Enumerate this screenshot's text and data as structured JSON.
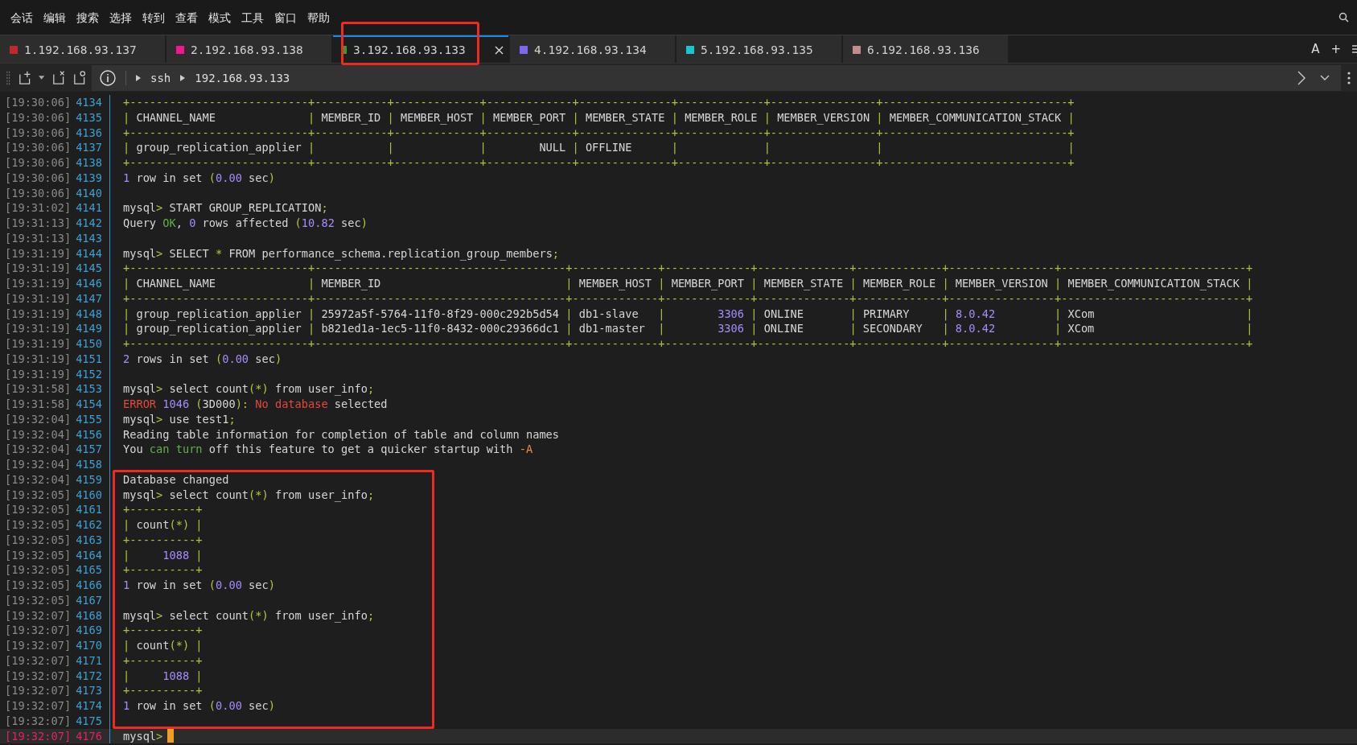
{
  "menu": [
    "会话",
    "编辑",
    "搜索",
    "选择",
    "转到",
    "查看",
    "模式",
    "工具",
    "窗口",
    "帮助"
  ],
  "tabs": [
    {
      "label": "1.192.168.93.137",
      "color": "#c0282d",
      "selected": false,
      "highlighted": false
    },
    {
      "label": "2.192.168.93.138",
      "color": "#f0168c",
      "selected": false,
      "highlighted": false
    },
    {
      "label": "3.192.168.93.133",
      "color": "#2e9e2e",
      "selected": true,
      "highlighted": true
    },
    {
      "label": "4.192.168.93.134",
      "color": "#7b68ee",
      "selected": false,
      "highlighted": false
    },
    {
      "label": "5.192.168.93.135",
      "color": "#14c8d0",
      "selected": false,
      "highlighted": false
    },
    {
      "label": "6.192.168.93.136",
      "color": "#c08c8c",
      "selected": false,
      "highlighted": false
    }
  ],
  "tab_bar_actions": [
    "A",
    "+"
  ],
  "toolbar": {
    "breadcrumb": [
      "ssh",
      "192.168.93.133"
    ]
  },
  "terminal": {
    "lines": [
      {
        "time": "[19:30:06]",
        "number": "4134",
        "current": false,
        "highlighted": false,
        "segments": [
          {
            "text": "+---------------------------+-----------+-------------+-------------+--------------+-------------+----------------+----------------------------+",
            "kind": "border"
          }
        ]
      },
      {
        "time": "[19:30:06]",
        "number": "4135",
        "current": false,
        "highlighted": false,
        "segments": [
          {
            "text": "| ",
            "kind": "border"
          },
          {
            "text": "CHANNEL_NAME",
            "kind": "text"
          },
          {
            "text": "              | ",
            "kind": "border"
          },
          {
            "text": "MEMBER_ID",
            "kind": "text"
          },
          {
            "text": " | ",
            "kind": "border"
          },
          {
            "text": "MEMBER_HOST",
            "kind": "text"
          },
          {
            "text": " | ",
            "kind": "border"
          },
          {
            "text": "MEMBER_PORT",
            "kind": "text"
          },
          {
            "text": " | ",
            "kind": "border"
          },
          {
            "text": "MEMBER_STATE",
            "kind": "text"
          },
          {
            "text": " | ",
            "kind": "border"
          },
          {
            "text": "MEMBER_ROLE",
            "kind": "text"
          },
          {
            "text": " | ",
            "kind": "border"
          },
          {
            "text": "MEMBER_VERSION",
            "kind": "text"
          },
          {
            "text": " | ",
            "kind": "border"
          },
          {
            "text": "MEMBER_COMMUNICATION_STACK",
            "kind": "text"
          },
          {
            "text": " |",
            "kind": "border"
          }
        ]
      },
      {
        "time": "[19:30:06]",
        "number": "4136",
        "current": false,
        "highlighted": false,
        "segments": [
          {
            "text": "+---------------------------+-----------+-------------+-------------+--------------+-------------+----------------+----------------------------+",
            "kind": "border"
          }
        ]
      },
      {
        "time": "[19:30:06]",
        "number": "4137",
        "current": false,
        "highlighted": false,
        "segments": [
          {
            "text": "| ",
            "kind": "border"
          },
          {
            "text": "group_replication_applier",
            "kind": "text"
          },
          {
            "text": " |           |             |        ",
            "kind": "border"
          },
          {
            "text": "NULL",
            "kind": "text"
          },
          {
            "text": " | ",
            "kind": "border"
          },
          {
            "text": "OFFLINE",
            "kind": "text"
          },
          {
            "text": "      |             |                |                            |",
            "kind": "border"
          }
        ]
      },
      {
        "time": "[19:30:06]",
        "number": "4138",
        "current": false,
        "highlighted": false,
        "segments": [
          {
            "text": "+---------------------------+-----------+-------------+-------------+--------------+-------------+----------------+----------------------------+",
            "kind": "border"
          }
        ]
      },
      {
        "time": "[19:30:06]",
        "number": "4139",
        "current": false,
        "highlighted": false,
        "segments": [
          {
            "text": "1",
            "kind": "number"
          },
          {
            "text": " row in set ",
            "kind": "text"
          },
          {
            "text": "(",
            "kind": "punct"
          },
          {
            "text": "0.00",
            "kind": "number"
          },
          {
            "text": " sec",
            "kind": "text"
          },
          {
            "text": ")",
            "kind": "punct"
          }
        ]
      },
      {
        "time": "[19:30:06]",
        "number": "4140",
        "current": false,
        "highlighted": false
      },
      {
        "time": "[19:31:02]",
        "number": "4141",
        "current": false,
        "highlighted": false,
        "segments": [
          {
            "text": "mysql",
            "kind": "text"
          },
          {
            "text": "> ",
            "kind": "punct"
          },
          {
            "text": "START GROUP_REPLICATION",
            "kind": "text"
          },
          {
            "text": ";",
            "kind": "punct"
          }
        ]
      },
      {
        "time": "[19:31:13]",
        "number": "4142",
        "current": false,
        "highlighted": false,
        "segments": [
          {
            "text": "Query ",
            "kind": "text"
          },
          {
            "text": "OK",
            "kind": "ok"
          },
          {
            "text": ", ",
            "kind": "text"
          },
          {
            "text": "0",
            "kind": "number"
          },
          {
            "text": " rows affected ",
            "kind": "text"
          },
          {
            "text": "(",
            "kind": "punct"
          },
          {
            "text": "10.82",
            "kind": "number"
          },
          {
            "text": " sec",
            "kind": "text"
          },
          {
            "text": ")",
            "kind": "punct"
          }
        ]
      },
      {
        "time": "[19:31:13]",
        "number": "4143",
        "current": false,
        "highlighted": false
      },
      {
        "time": "[19:31:19]",
        "number": "4144",
        "current": false,
        "highlighted": false,
        "segments": [
          {
            "text": "mysql",
            "kind": "text"
          },
          {
            "text": "> ",
            "kind": "punct"
          },
          {
            "text": "SELECT ",
            "kind": "text"
          },
          {
            "text": "* ",
            "kind": "punct"
          },
          {
            "text": "FROM performance_schema.replication_group_members",
            "kind": "text"
          },
          {
            "text": ";",
            "kind": "punct"
          }
        ]
      },
      {
        "time": "[19:31:19]",
        "number": "4145",
        "current": false,
        "highlighted": false,
        "segments": [
          {
            "text": "+---------------------------+--------------------------------------+-------------+-------------+--------------+-------------+----------------+----------------------------+",
            "kind": "border"
          }
        ]
      },
      {
        "time": "[19:31:19]",
        "number": "4146",
        "current": false,
        "highlighted": false,
        "segments": [
          {
            "text": "| ",
            "kind": "border"
          },
          {
            "text": "CHANNEL_NAME",
            "kind": "text"
          },
          {
            "text": "              | ",
            "kind": "border"
          },
          {
            "text": "MEMBER_ID",
            "kind": "text"
          },
          {
            "text": "                            | ",
            "kind": "border"
          },
          {
            "text": "MEMBER_HOST",
            "kind": "text"
          },
          {
            "text": " | ",
            "kind": "border"
          },
          {
            "text": "MEMBER_PORT",
            "kind": "text"
          },
          {
            "text": " | ",
            "kind": "border"
          },
          {
            "text": "MEMBER_STATE",
            "kind": "text"
          },
          {
            "text": " | ",
            "kind": "border"
          },
          {
            "text": "MEMBER_ROLE",
            "kind": "text"
          },
          {
            "text": " | ",
            "kind": "border"
          },
          {
            "text": "MEMBER_VERSION",
            "kind": "text"
          },
          {
            "text": " | ",
            "kind": "border"
          },
          {
            "text": "MEMBER_COMMUNICATION_STACK",
            "kind": "text"
          },
          {
            "text": " |",
            "kind": "border"
          }
        ]
      },
      {
        "time": "[19:31:19]",
        "number": "4147",
        "current": false,
        "highlighted": false,
        "segments": [
          {
            "text": "+---------------------------+--------------------------------------+-------------+-------------+--------------+-------------+----------------+----------------------------+",
            "kind": "border"
          }
        ]
      },
      {
        "time": "[19:31:19]",
        "number": "4148",
        "current": false,
        "highlighted": false,
        "segments": [
          {
            "text": "| ",
            "kind": "border"
          },
          {
            "text": "group_replication_applier",
            "kind": "text"
          },
          {
            "text": " | ",
            "kind": "border"
          },
          {
            "text": "25972a5f-5764-11f0-8f29-000c292b5d54",
            "kind": "text"
          },
          {
            "text": " | ",
            "kind": "border"
          },
          {
            "text": "db1-slave",
            "kind": "text"
          },
          {
            "text": "   |        ",
            "kind": "border"
          },
          {
            "text": "3306",
            "kind": "number"
          },
          {
            "text": " | ",
            "kind": "border"
          },
          {
            "text": "ONLINE",
            "kind": "text"
          },
          {
            "text": "       | ",
            "kind": "border"
          },
          {
            "text": "PRIMARY",
            "kind": "text"
          },
          {
            "text": "     | ",
            "kind": "border"
          },
          {
            "text": "8.0.42",
            "kind": "number"
          },
          {
            "text": "         | ",
            "kind": "border"
          },
          {
            "text": "XCom",
            "kind": "text"
          },
          {
            "text": "                       |",
            "kind": "border"
          }
        ]
      },
      {
        "time": "[19:31:19]",
        "number": "4149",
        "current": false,
        "highlighted": false,
        "segments": [
          {
            "text": "| ",
            "kind": "border"
          },
          {
            "text": "group_replication_applier",
            "kind": "text"
          },
          {
            "text": " | ",
            "kind": "border"
          },
          {
            "text": "b821ed1a-1ec5-11f0-8432-000c29366dc1",
            "kind": "text"
          },
          {
            "text": " | ",
            "kind": "border"
          },
          {
            "text": "db1-master",
            "kind": "text"
          },
          {
            "text": "  |        ",
            "kind": "border"
          },
          {
            "text": "3306",
            "kind": "number"
          },
          {
            "text": " | ",
            "kind": "border"
          },
          {
            "text": "ONLINE",
            "kind": "text"
          },
          {
            "text": "       | ",
            "kind": "border"
          },
          {
            "text": "SECONDARY",
            "kind": "text"
          },
          {
            "text": "   | ",
            "kind": "border"
          },
          {
            "text": "8.0.42",
            "kind": "number"
          },
          {
            "text": "         | ",
            "kind": "border"
          },
          {
            "text": "XCom",
            "kind": "text"
          },
          {
            "text": "                       |",
            "kind": "border"
          }
        ]
      },
      {
        "time": "[19:31:19]",
        "number": "4150",
        "current": false,
        "highlighted": false,
        "segments": [
          {
            "text": "+---------------------------+--------------------------------------+-------------+-------------+--------------+-------------+----------------+----------------------------+",
            "kind": "border"
          }
        ]
      },
      {
        "time": "[19:31:19]",
        "number": "4151",
        "current": false,
        "highlighted": false,
        "segments": [
          {
            "text": "2",
            "kind": "number"
          },
          {
            "text": " rows in set ",
            "kind": "text"
          },
          {
            "text": "(",
            "kind": "punct"
          },
          {
            "text": "0.00",
            "kind": "number"
          },
          {
            "text": " sec",
            "kind": "text"
          },
          {
            "text": ")",
            "kind": "punct"
          }
        ]
      },
      {
        "time": "[19:31:19]",
        "number": "4152",
        "current": false,
        "highlighted": false
      },
      {
        "time": "[19:31:58]",
        "number": "4153",
        "current": false,
        "highlighted": false,
        "segments": [
          {
            "text": "mysql",
            "kind": "text"
          },
          {
            "text": "> ",
            "kind": "punct"
          },
          {
            "text": "select count",
            "kind": "text"
          },
          {
            "text": "(*)",
            "kind": "punct"
          },
          {
            "text": " from user_info",
            "kind": "text"
          },
          {
            "text": ";",
            "kind": "punct"
          }
        ]
      },
      {
        "time": "[19:31:58]",
        "number": "4154",
        "current": false,
        "highlighted": false,
        "segments": [
          {
            "text": "ERROR ",
            "kind": "error"
          },
          {
            "text": "1046",
            "kind": "number"
          },
          {
            "text": " (",
            "kind": "punct"
          },
          {
            "text": "3D000",
            "kind": "text"
          },
          {
            "text": "): ",
            "kind": "punct"
          },
          {
            "text": "No database",
            "kind": "error"
          },
          {
            "text": " selected",
            "kind": "text"
          }
        ]
      },
      {
        "time": "[19:32:04]",
        "number": "4155",
        "current": false,
        "highlighted": false,
        "segments": [
          {
            "text": "mysql",
            "kind": "text"
          },
          {
            "text": "> ",
            "kind": "punct"
          },
          {
            "text": "use test1",
            "kind": "text"
          },
          {
            "text": ";",
            "kind": "punct"
          }
        ]
      },
      {
        "time": "[19:32:04]",
        "number": "4156",
        "current": false,
        "highlighted": false,
        "segments": [
          {
            "text": "Reading table information for completion of table and column names",
            "kind": "text"
          }
        ]
      },
      {
        "time": "[19:32:04]",
        "number": "4157",
        "current": false,
        "highlighted": false,
        "segments": [
          {
            "text": "You ",
            "kind": "text"
          },
          {
            "text": "can turn",
            "kind": "ok"
          },
          {
            "text": " off this feature to get a quicker startup with ",
            "kind": "text"
          },
          {
            "text": "-A",
            "kind": "flag"
          }
        ]
      },
      {
        "time": "[19:32:04]",
        "number": "4158",
        "current": false,
        "highlighted": false
      },
      {
        "time": "[19:32:04]",
        "number": "4159",
        "current": false,
        "highlighted": true,
        "segments": [
          {
            "text": "Database changed",
            "kind": "text"
          }
        ]
      },
      {
        "time": "[19:32:05]",
        "number": "4160",
        "current": false,
        "highlighted": true,
        "segments": [
          {
            "text": "mysql",
            "kind": "text"
          },
          {
            "text": "> ",
            "kind": "punct"
          },
          {
            "text": "select count",
            "kind": "text"
          },
          {
            "text": "(*)",
            "kind": "punct"
          },
          {
            "text": " from user_info",
            "kind": "text"
          },
          {
            "text": ";",
            "kind": "punct"
          }
        ]
      },
      {
        "time": "[19:32:05]",
        "number": "4161",
        "current": false,
        "highlighted": true,
        "segments": [
          {
            "text": "+----------+",
            "kind": "border"
          }
        ]
      },
      {
        "time": "[19:32:05]",
        "number": "4162",
        "current": false,
        "highlighted": true,
        "segments": [
          {
            "text": "| ",
            "kind": "border"
          },
          {
            "text": "count",
            "kind": "text"
          },
          {
            "text": "(*)",
            "kind": "punct"
          },
          {
            "text": " |",
            "kind": "border"
          }
        ]
      },
      {
        "time": "[19:32:05]",
        "number": "4163",
        "current": false,
        "highlighted": true,
        "segments": [
          {
            "text": "+----------+",
            "kind": "border"
          }
        ]
      },
      {
        "time": "[19:32:05]",
        "number": "4164",
        "current": false,
        "highlighted": true,
        "segments": [
          {
            "text": "|     ",
            "kind": "border"
          },
          {
            "text": "1088",
            "kind": "number"
          },
          {
            "text": " |",
            "kind": "border"
          }
        ]
      },
      {
        "time": "[19:32:05]",
        "number": "4165",
        "current": false,
        "highlighted": true,
        "segments": [
          {
            "text": "+----------+",
            "kind": "border"
          }
        ]
      },
      {
        "time": "[19:32:05]",
        "number": "4166",
        "current": false,
        "highlighted": true,
        "segments": [
          {
            "text": "1",
            "kind": "number"
          },
          {
            "text": " row in set ",
            "kind": "text"
          },
          {
            "text": "(",
            "kind": "punct"
          },
          {
            "text": "0.00",
            "kind": "number"
          },
          {
            "text": " sec",
            "kind": "text"
          },
          {
            "text": ")",
            "kind": "punct"
          }
        ]
      },
      {
        "time": "[19:32:05]",
        "number": "4167",
        "current": false,
        "highlighted": true
      },
      {
        "time": "[19:32:07]",
        "number": "4168",
        "current": false,
        "highlighted": true,
        "segments": [
          {
            "text": "mysql",
            "kind": "text"
          },
          {
            "text": "> ",
            "kind": "punct"
          },
          {
            "text": "select count",
            "kind": "text"
          },
          {
            "text": "(*)",
            "kind": "punct"
          },
          {
            "text": " from user_info",
            "kind": "text"
          },
          {
            "text": ";",
            "kind": "punct"
          }
        ]
      },
      {
        "time": "[19:32:07]",
        "number": "4169",
        "current": false,
        "highlighted": true,
        "segments": [
          {
            "text": "+----------+",
            "kind": "border"
          }
        ]
      },
      {
        "time": "[19:32:07]",
        "number": "4170",
        "current": false,
        "highlighted": true,
        "segments": [
          {
            "text": "| ",
            "kind": "border"
          },
          {
            "text": "count",
            "kind": "text"
          },
          {
            "text": "(*)",
            "kind": "punct"
          },
          {
            "text": " |",
            "kind": "border"
          }
        ]
      },
      {
        "time": "[19:32:07]",
        "number": "4171",
        "current": false,
        "highlighted": true,
        "segments": [
          {
            "text": "+----------+",
            "kind": "border"
          }
        ]
      },
      {
        "time": "[19:32:07]",
        "number": "4172",
        "current": false,
        "highlighted": true,
        "segments": [
          {
            "text": "|     ",
            "kind": "border"
          },
          {
            "text": "1088",
            "kind": "number"
          },
          {
            "text": " |",
            "kind": "border"
          }
        ]
      },
      {
        "time": "[19:32:07]",
        "number": "4173",
        "current": false,
        "highlighted": true,
        "segments": [
          {
            "text": "+----------+",
            "kind": "border"
          }
        ]
      },
      {
        "time": "[19:32:07]",
        "number": "4174",
        "current": false,
        "highlighted": true,
        "segments": [
          {
            "text": "1",
            "kind": "number"
          },
          {
            "text": " row in set ",
            "kind": "text"
          },
          {
            "text": "(",
            "kind": "punct"
          },
          {
            "text": "0.00",
            "kind": "number"
          },
          {
            "text": " sec",
            "kind": "text"
          },
          {
            "text": ")",
            "kind": "punct"
          }
        ]
      },
      {
        "time": "[19:32:07]",
        "number": "4175",
        "current": false,
        "highlighted": true
      },
      {
        "time": "[19:32:07]",
        "number": "4176",
        "current": true,
        "highlighted": false,
        "segments": [
          {
            "text": "mysql",
            "kind": "text"
          },
          {
            "text": ">",
            "kind": "punct"
          }
        ]
      }
    ]
  }
}
